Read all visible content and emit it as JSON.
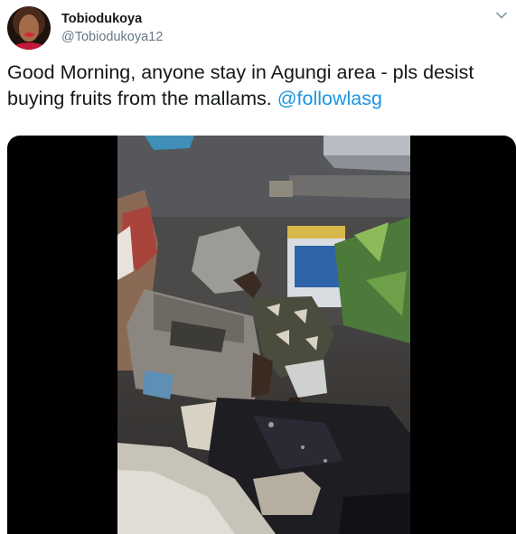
{
  "tweet": {
    "author": {
      "display_name": "Tobiodukoya",
      "handle": "@Tobiodukoya12"
    },
    "text_before_mention": "Good Morning, anyone stay in Agungi area - pls desist buying fruits from the mallams. ",
    "mention": "@followlasg"
  },
  "icons": {
    "menu": "chevron-down-icon",
    "avatar": "profile-photo"
  },
  "colors": {
    "text": "#14171a",
    "secondary_text": "#657786",
    "link": "#1b95e0",
    "media_background": "#000000"
  }
}
